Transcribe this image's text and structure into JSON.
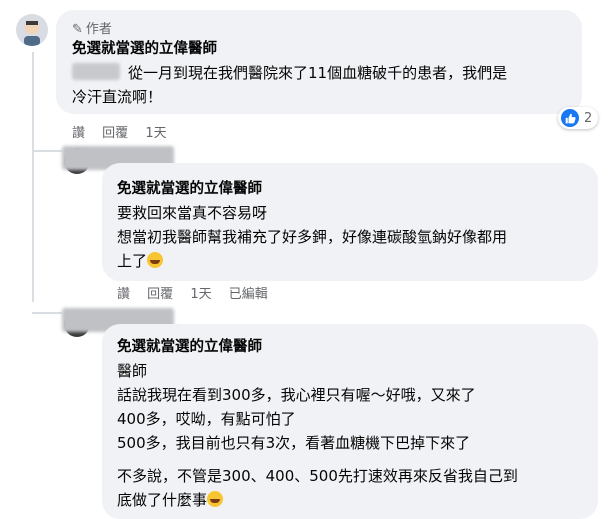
{
  "comments": [
    {
      "badge": "作者",
      "author": "免選就當選的立偉醫師",
      "lines": [
        "從一月到現在我們醫院來了11個血糖破千的患者，我們是",
        "冷汗直流啊！"
      ],
      "actions": {
        "like": "讚",
        "reply": "回覆",
        "time": "1天"
      },
      "reaction_count": "2"
    },
    {
      "author": "免選就當選的立偉醫師",
      "lines": [
        "要救回來當真不容易呀",
        "想當初我醫師幫我補充了好多鉀，好像連碳酸氫鈉好像都用",
        "上了"
      ],
      "actions": {
        "like": "讚",
        "reply": "回覆",
        "time": "1天",
        "edited": "已編輯"
      }
    },
    {
      "author": "免選就當選的立偉醫師",
      "lines": [
        "醫師",
        "話說我現在看到300多，我心裡只有喔～好哦，又來了",
        "400多，哎呦，有點可怕了",
        "500多，我目前也只有3次，看著血糖機下巴掉下來了",
        "不多說，不管是300、400、500先打速效再來反省我自己到",
        "底做了什麼事"
      ]
    }
  ],
  "colors": {
    "bubble": "#f0f2f5",
    "meta": "#65676b",
    "like_blue": "#1877f2"
  }
}
